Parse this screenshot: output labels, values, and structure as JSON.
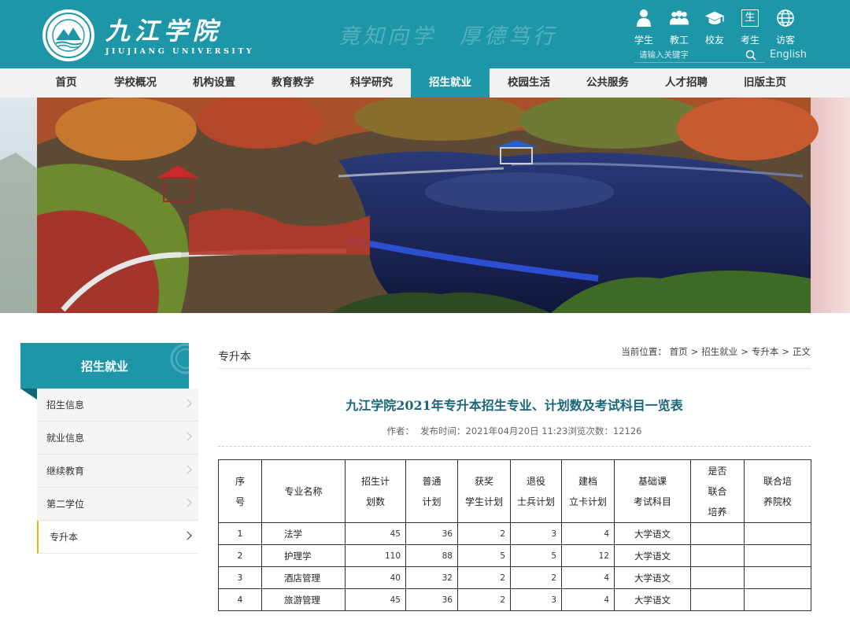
{
  "header": {
    "logo_name": "九江学院",
    "logo_en": "JIUJIANG  UNIVERSITY",
    "seal_text_cn": "九江学院",
    "seal_text_en": "JIUJIANG UNIVERSITY",
    "motto": [
      "竟知向学",
      "厚德笃行"
    ],
    "quick_links": [
      {
        "label": "学生",
        "icon": "student-icon"
      },
      {
        "label": "教工",
        "icon": "staff-icon"
      },
      {
        "label": "校友",
        "icon": "alumni-cap-icon"
      },
      {
        "label": "考生",
        "icon": "examinee-icon",
        "glyph": "生"
      },
      {
        "label": "访客",
        "icon": "globe-icon"
      }
    ],
    "search_placeholder": "请输入关键字",
    "english_link": "English"
  },
  "nav": {
    "items": [
      "首页",
      "学校概况",
      "机构设置",
      "教育教学",
      "科学研究",
      "招生就业",
      "校园生活",
      "公共服务",
      "人才招聘",
      "旧版主页"
    ],
    "active_index": 5
  },
  "sidebar": {
    "title": "招生就业",
    "items": [
      "招生信息",
      "就业信息",
      "继续教育",
      "第二学位",
      "专升本"
    ],
    "active_index": 4
  },
  "content": {
    "section_title": "专升本",
    "breadcrumb": {
      "prefix": "当前位置：",
      "items": [
        "首页",
        "招生就业",
        "专升本",
        "正文"
      ]
    },
    "article": {
      "title": "九江学院2021年专升本招生专业、计划数及考试科目一览表",
      "author_label": "作者：",
      "published_label": "发布时间：",
      "published_value": "2021年04月20日 11:23",
      "views_label": "浏览次数：",
      "views_value": "12126"
    },
    "table": {
      "headers": [
        [
          "序",
          "号"
        ],
        [
          "专业名称"
        ],
        [
          "招生计",
          "划数"
        ],
        [
          "普通",
          "计划"
        ],
        [
          "获奖",
          "学生计划"
        ],
        [
          "退役",
          "士兵计划"
        ],
        [
          "建档",
          "立卡计划"
        ],
        [
          "基础课",
          "考试科目"
        ],
        [
          "是否",
          "联合",
          "培养"
        ],
        [
          "联合培",
          "养院校"
        ]
      ],
      "rows": [
        {
          "no": "1",
          "major": "法学",
          "total": "45",
          "normal": "36",
          "award": "2",
          "veteran": "3",
          "poverty": "4",
          "subject": "大学语文",
          "joint": "",
          "school": ""
        },
        {
          "no": "2",
          "major": "护理学",
          "total": "110",
          "normal": "88",
          "award": "5",
          "veteran": "5",
          "poverty": "12",
          "subject": "大学语文",
          "joint": "",
          "school": ""
        },
        {
          "no": "3",
          "major": "酒店管理",
          "total": "40",
          "normal": "32",
          "award": "2",
          "veteran": "2",
          "poverty": "4",
          "subject": "大学语文",
          "joint": "",
          "school": ""
        },
        {
          "no": "4",
          "major": "旅游管理",
          "total": "45",
          "normal": "36",
          "award": "2",
          "veteran": "3",
          "poverty": "4",
          "subject": "大学语文",
          "joint": "",
          "school": ""
        }
      ]
    }
  },
  "colors": {
    "brand_teal": "#1d96a8",
    "sidebar_active_accent": "#f0b400",
    "article_title": "#19657a"
  }
}
